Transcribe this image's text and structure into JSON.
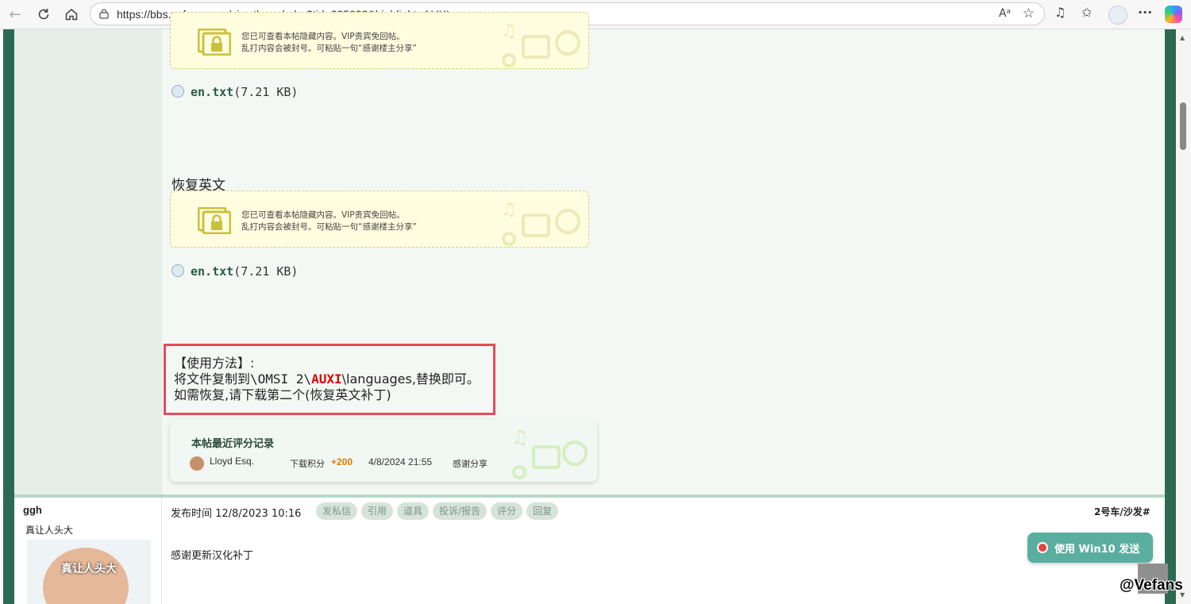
{
  "browser": {
    "url": "https://bbs.vefans.com/viewthread.php?tid=235033&highlight=AUXI",
    "read_aloud": "Aᵃ"
  },
  "colors": {
    "frame": "#2c6a54",
    "highlight_red": "#e00000",
    "usage_border": "#e84a5a",
    "points": "#e07800",
    "win10_button": "#5aaea0"
  },
  "icons": [
    "back-arrow-icon",
    "refresh-icon",
    "home-icon",
    "lock-icon",
    "read-aloud-icon",
    "favorite-star-icon",
    "music-extension-icon",
    "favorites-icon",
    "profile-icon",
    "more-icon",
    "copilot-icon",
    "file-icon",
    "hidden-lock-icon",
    "music-note-icon",
    "film-reel-icon"
  ],
  "hidden_notice": {
    "line1": "您已可查看本帖隐藏内容。VIP贵宾免回帖。",
    "line2": "乱打内容会被封号。可粘贴一句“感谢楼主分享”"
  },
  "attachments": [
    {
      "name": "en.txt",
      "size": "(7.21 KB)"
    },
    {
      "name": "en.txt",
      "size": "(7.21 KB)"
    }
  ],
  "restore_heading": "恢复英文",
  "usage": {
    "title": "【使用方法】:",
    "line2_prefix": "将文件复制到\\OMSI 2\\",
    "line2_highlight": "AUXI",
    "line2_suffix": "\\languages,替换即可。",
    "line3": "如需恢复,请下载第二个(恢复英文补丁)"
  },
  "rating": {
    "title": "本帖最近评分记录",
    "user": "Lloyd Esq.",
    "label": "下载积分",
    "points": "+200",
    "date": "4/8/2024 21:55",
    "reason": "感谢分享"
  },
  "post2": {
    "username": "ggh",
    "user_title": "真让人头大",
    "avatar_caption": "真让人头大",
    "post_time": "发布时间 12/8/2023 10:16",
    "actions": [
      "发私信",
      "引用",
      "道具",
      "投诉/报告",
      "评分",
      "回复"
    ],
    "floor": "2号车/沙发#",
    "content": "感谢更新汉化补丁"
  },
  "floating": {
    "win10_label": "使用 Win10 发送",
    "back_to_top": "︿",
    "watermark": "@Vefans"
  }
}
